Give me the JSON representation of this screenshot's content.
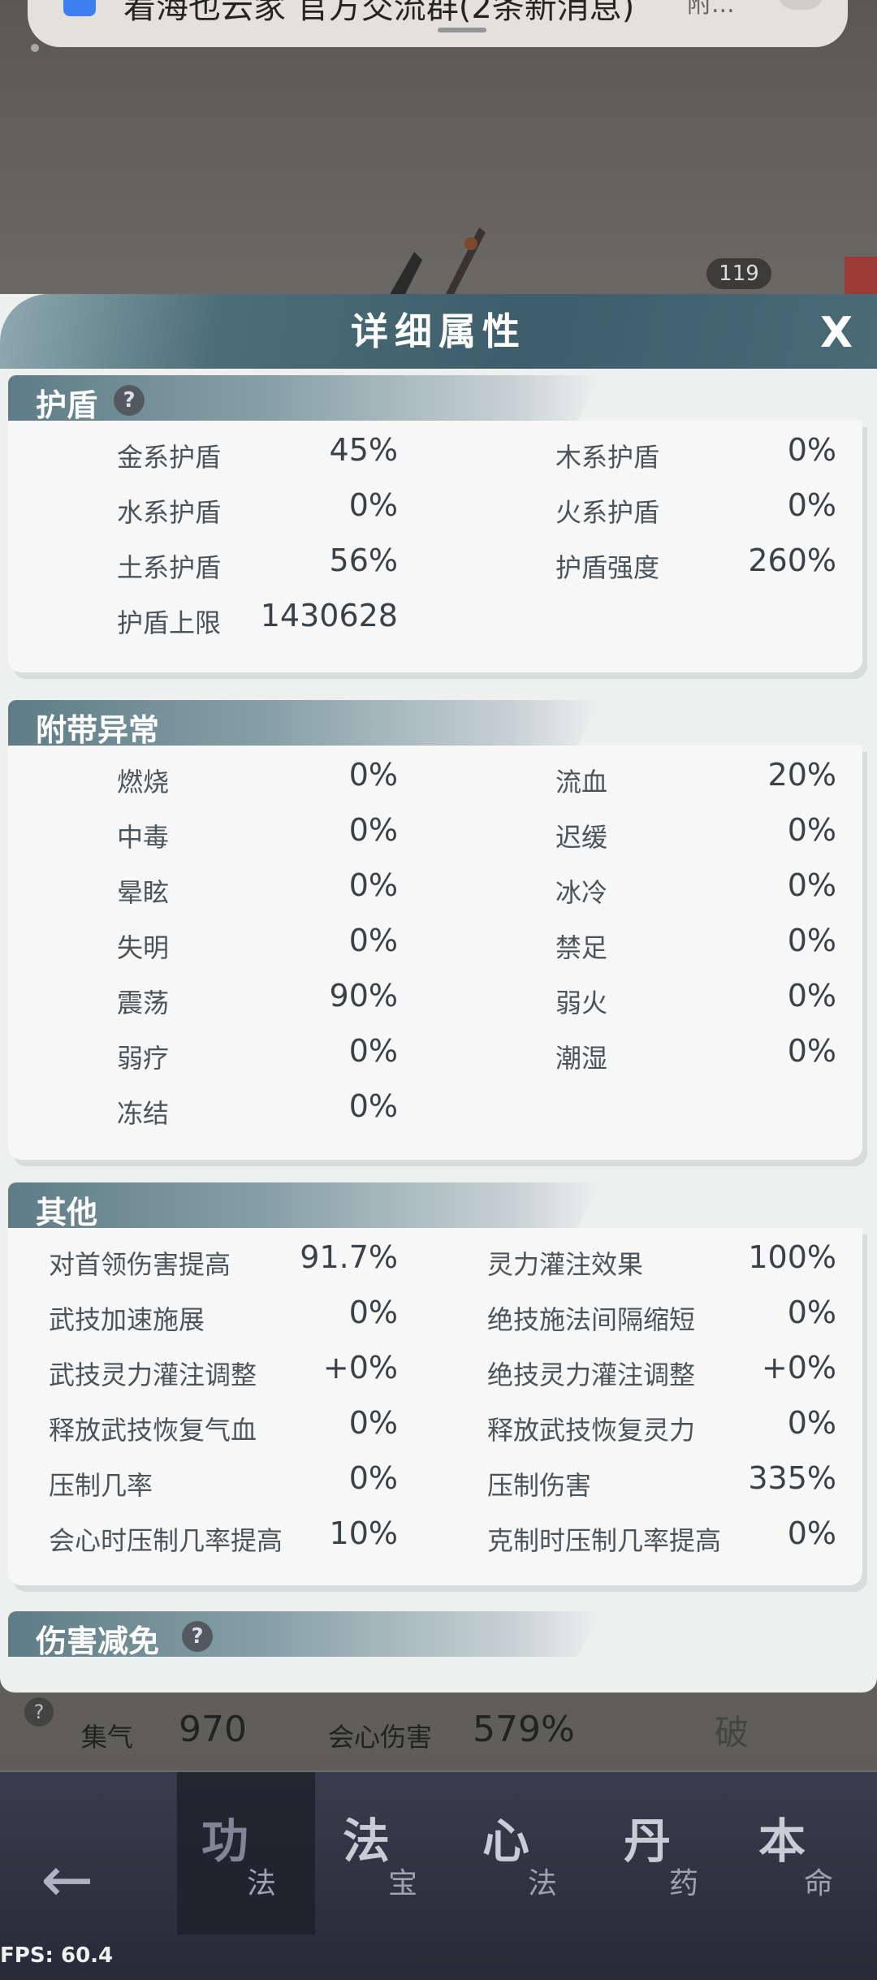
{
  "notification": {
    "text": "着海也云家 官方交流群(2条新消息)",
    "more": "附..."
  },
  "background": {
    "counter": "119",
    "stats": [
      {
        "label": "集气",
        "value": "970"
      },
      {
        "label": "会心伤害",
        "value": "579%"
      }
    ],
    "breakthrough": "破",
    "help": "?"
  },
  "panel": {
    "title": "详细属性",
    "close": "X",
    "sections": {
      "shield": {
        "title": "护盾",
        "help": "?",
        "items": [
          {
            "label": "金系护盾",
            "value": "45%"
          },
          {
            "label": "木系护盾",
            "value": "0%"
          },
          {
            "label": "水系护盾",
            "value": "0%"
          },
          {
            "label": "火系护盾",
            "value": "0%"
          },
          {
            "label": "土系护盾",
            "value": "56%"
          },
          {
            "label": "护盾强度",
            "value": "260%"
          },
          {
            "label": "护盾上限",
            "value": "1430628"
          }
        ]
      },
      "abnormal": {
        "title": "附带异常",
        "items": [
          {
            "label": "燃烧",
            "value": "0%"
          },
          {
            "label": "流血",
            "value": "20%"
          },
          {
            "label": "中毒",
            "value": "0%"
          },
          {
            "label": "迟缓",
            "value": "0%"
          },
          {
            "label": "晕眩",
            "value": "0%"
          },
          {
            "label": "冰冷",
            "value": "0%"
          },
          {
            "label": "失明",
            "value": "0%"
          },
          {
            "label": "禁足",
            "value": "0%"
          },
          {
            "label": "震荡",
            "value": "90%"
          },
          {
            "label": "弱火",
            "value": "0%"
          },
          {
            "label": "弱疗",
            "value": "0%"
          },
          {
            "label": "潮湿",
            "value": "0%"
          },
          {
            "label": "冻结",
            "value": "0%"
          }
        ]
      },
      "other": {
        "title": "其他",
        "items": [
          {
            "label": "对首领伤害提高",
            "value": "91.7%"
          },
          {
            "label": "灵力灌注效果",
            "value": "100%"
          },
          {
            "label": "武技加速施展",
            "value": "0%"
          },
          {
            "label": "绝技施法间隔缩短",
            "value": "0%"
          },
          {
            "label": "武技灵力灌注调整",
            "value": "+0%"
          },
          {
            "label": "绝技灵力灌注调整",
            "value": "+0%"
          },
          {
            "label": "释放武技恢复气血",
            "value": "0%"
          },
          {
            "label": "释放武技恢复灵力",
            "value": "0%"
          },
          {
            "label": "压制几率",
            "value": "0%"
          },
          {
            "label": "压制伤害",
            "value": "335%"
          },
          {
            "label": "会心时压制几率提高",
            "value": "10%"
          },
          {
            "label": "克制时压制几率提高",
            "value": "0%"
          }
        ]
      },
      "damage_reduction": {
        "title": "伤害减免",
        "help": "?"
      }
    }
  },
  "nav": {
    "back": "←",
    "tabs": [
      {
        "big": "功",
        "small": "法",
        "active": true
      },
      {
        "big": "法",
        "small": "宝"
      },
      {
        "big": "心",
        "small": "法"
      },
      {
        "big": "丹",
        "small": "药"
      },
      {
        "big": "本",
        "small": "命"
      }
    ]
  },
  "fps": "FPS: 60.4",
  "colors": {
    "header": "#3d5d6a",
    "panel_bg": "#eef0ef",
    "nav_bg": "#262b36"
  }
}
